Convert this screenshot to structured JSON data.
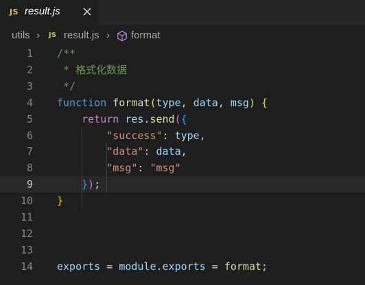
{
  "tab": {
    "icon": "JS",
    "label": "result.js",
    "close": "close-icon"
  },
  "breadcrumb": {
    "folder": "utils",
    "file_icon": "JS",
    "file": "result.js",
    "symbol_icon": "cube-icon",
    "symbol": "format"
  },
  "editor": {
    "active_line": 9,
    "line_numbers": [
      "1",
      "2",
      "3",
      "4",
      "5",
      "6",
      "7",
      "8",
      "9",
      "10",
      "11",
      "12",
      "13",
      "14"
    ],
    "lines": [
      [
        {
          "t": "/**",
          "c": "com"
        }
      ],
      [
        {
          "t": " * 格式化数据",
          "c": "com"
        }
      ],
      [
        {
          "t": " */",
          "c": "com"
        }
      ],
      [
        {
          "t": "function",
          "c": "kw"
        },
        {
          "t": " ",
          "c": "pun"
        },
        {
          "t": "format",
          "c": "fn"
        },
        {
          "t": "(",
          "c": "br1"
        },
        {
          "t": "type",
          "c": "var"
        },
        {
          "t": ", ",
          "c": "pun"
        },
        {
          "t": "data",
          "c": "var"
        },
        {
          "t": ", ",
          "c": "pun"
        },
        {
          "t": "msg",
          "c": "var"
        },
        {
          "t": ")",
          "c": "br1"
        },
        {
          "t": " ",
          "c": "pun"
        },
        {
          "t": "{",
          "c": "br1"
        }
      ],
      [
        {
          "t": "    ",
          "c": "pun"
        },
        {
          "t": "return",
          "c": "kw2"
        },
        {
          "t": " ",
          "c": "pun"
        },
        {
          "t": "res",
          "c": "var"
        },
        {
          "t": ".",
          "c": "pun"
        },
        {
          "t": "send",
          "c": "fn"
        },
        {
          "t": "(",
          "c": "br2"
        },
        {
          "t": "{",
          "c": "br3"
        }
      ],
      [
        {
          "t": "        ",
          "c": "pun"
        },
        {
          "t": "\"success\"",
          "c": "str"
        },
        {
          "t": ": ",
          "c": "pun"
        },
        {
          "t": "type",
          "c": "var"
        },
        {
          "t": ",",
          "c": "pun"
        }
      ],
      [
        {
          "t": "        ",
          "c": "pun"
        },
        {
          "t": "\"data\"",
          "c": "str"
        },
        {
          "t": ": ",
          "c": "pun"
        },
        {
          "t": "data",
          "c": "var"
        },
        {
          "t": ",",
          "c": "pun"
        }
      ],
      [
        {
          "t": "        ",
          "c": "pun"
        },
        {
          "t": "\"msg\"",
          "c": "str"
        },
        {
          "t": ": ",
          "c": "pun"
        },
        {
          "t": "\"msg\"",
          "c": "str"
        }
      ],
      [
        {
          "t": "    ",
          "c": "pun"
        },
        {
          "t": "}",
          "c": "br3"
        },
        {
          "t": ")",
          "c": "br2"
        },
        {
          "t": ";",
          "c": "pun"
        }
      ],
      [
        {
          "t": "}",
          "c": "br1"
        }
      ],
      [],
      [],
      [],
      [
        {
          "t": "exports",
          "c": "var"
        },
        {
          "t": " = ",
          "c": "pun"
        },
        {
          "t": "module",
          "c": "var"
        },
        {
          "t": ".",
          "c": "pun"
        },
        {
          "t": "exports",
          "c": "var"
        },
        {
          "t": " = ",
          "c": "pun"
        },
        {
          "t": "format",
          "c": "fn"
        },
        {
          "t": ";",
          "c": "pun"
        }
      ]
    ]
  }
}
